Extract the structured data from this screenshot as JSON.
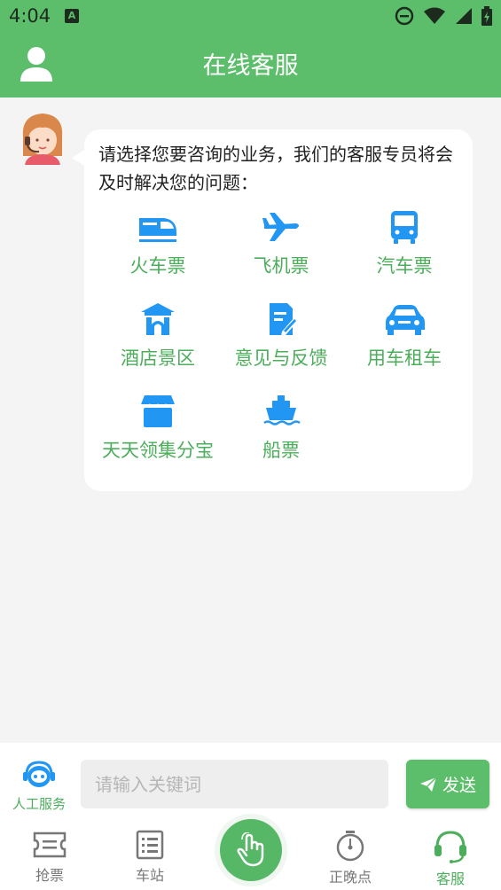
{
  "status_bar": {
    "time": "4:04",
    "badge": "A"
  },
  "header": {
    "title": "在线客服",
    "user_icon": "user-icon"
  },
  "chat": {
    "intro": "请选择您要咨询的业务，我们的客服专员将会及时解决您的问题：",
    "services": [
      {
        "label": "火车票",
        "icon": "train-icon"
      },
      {
        "label": "飞机票",
        "icon": "plane-icon"
      },
      {
        "label": "汽车票",
        "icon": "bus-icon"
      },
      {
        "label": "酒店景区",
        "icon": "hotel-icon"
      },
      {
        "label": "意见与反馈",
        "icon": "feedback-icon"
      },
      {
        "label": "用车租车",
        "icon": "car-icon"
      },
      {
        "label": "天天领集分宝",
        "icon": "shop-icon"
      },
      {
        "label": "船票",
        "icon": "ship-icon"
      }
    ]
  },
  "input": {
    "manual_label": "人工服务",
    "placeholder": "请输入关键词",
    "value": "",
    "send_label": "发送"
  },
  "tabs": [
    {
      "label": "抢票",
      "icon": "ticket-icon",
      "active": false
    },
    {
      "label": "车站",
      "icon": "station-list-icon",
      "active": false
    },
    {
      "label": "",
      "icon": "tap-hand-icon",
      "active": false
    },
    {
      "label": "正晚点",
      "icon": "stopwatch-icon",
      "active": false
    },
    {
      "label": "客服",
      "icon": "headset-icon",
      "active": true
    }
  ],
  "colors": {
    "brand": "#5cbd6b",
    "icon_blue": "#2196f3",
    "label_green": "#4cae5b"
  }
}
